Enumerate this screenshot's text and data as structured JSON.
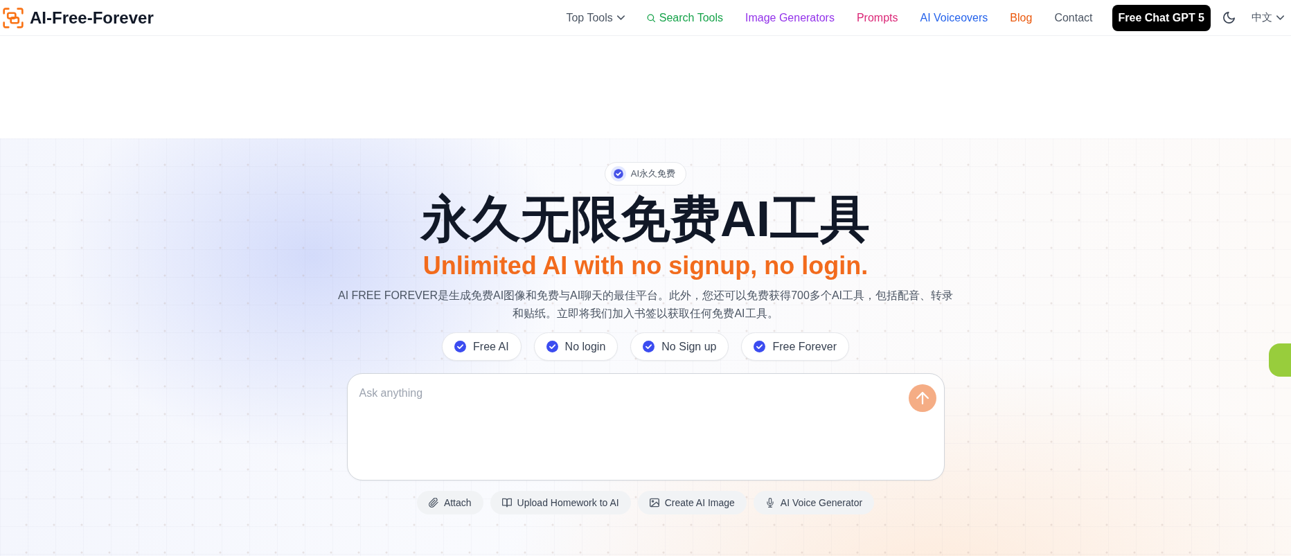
{
  "header": {
    "logo_text": "AI-Free-Forever",
    "nav": [
      {
        "label": "Top Tools",
        "kind": "dropdown",
        "color": "#4b5563"
      },
      {
        "label": "Search Tools",
        "kind": "search",
        "color": "#16a34a"
      },
      {
        "label": "Image Generators",
        "kind": "link",
        "color": "#9333ea"
      },
      {
        "label": "Prompts",
        "kind": "link",
        "color": "#db2777"
      },
      {
        "label": "AI Voiceovers",
        "kind": "link",
        "color": "#2563eb"
      },
      {
        "label": "Blog",
        "kind": "link",
        "color": "#ea580c"
      },
      {
        "label": "Contact",
        "kind": "link",
        "color": "#4b5563"
      }
    ],
    "cta": "Free Chat GPT 5",
    "language": "中文"
  },
  "hero": {
    "badge": "AI永久免费",
    "title": "永久无限免费AI工具",
    "subtitle": "Unlimited AI with no signup, no login.",
    "description": "AI FREE FOREVER是生成免费AI图像和免费与AI聊天的最佳平台。此外，您还可以免费获得700多个AI工具，包括配音、转录和贴纸。立即将我们加入书签以获取任何免费AI工具。",
    "features": [
      "Free AI",
      "No login",
      "No Sign up",
      "Free Forever"
    ]
  },
  "chat": {
    "placeholder": "Ask anything",
    "send_button": {
      "disabled": true
    },
    "actions": [
      {
        "label": "Attach",
        "kind": "attach"
      },
      {
        "label": "Upload Homework to AI",
        "kind": "homework"
      },
      {
        "label": "Create AI Image",
        "kind": "image"
      },
      {
        "label": "AI Voice Generator",
        "kind": "voice"
      }
    ]
  }
}
